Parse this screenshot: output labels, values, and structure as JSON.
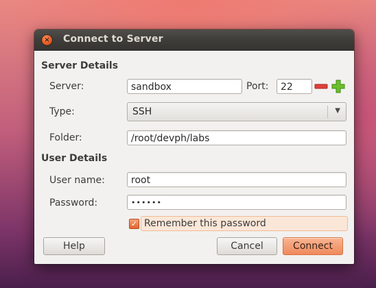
{
  "window": {
    "title": "Connect to Server",
    "close_glyph": "×"
  },
  "server_details": {
    "heading": "Server Details",
    "server_label": "Server:",
    "server_value": "sandbox",
    "port_label": "Port:",
    "port_value": "22",
    "type_label": "Type:",
    "type_value": "SSH",
    "folder_label": "Folder:",
    "folder_value": "/root/devph/labs"
  },
  "user_details": {
    "heading": "User Details",
    "username_label": "User name:",
    "username_value": "root",
    "password_label": "Password:",
    "password_value": "••••••",
    "remember_label": "Remember this password",
    "remember_checked": true
  },
  "buttons": {
    "help": "Help",
    "cancel": "Cancel",
    "connect": "Connect"
  },
  "icons": {
    "close": "close-icon",
    "port_decrement": "minus-icon",
    "port_increment": "plus-icon",
    "dropdown": "chevron-down-icon",
    "checkmark": "checkmark-icon"
  },
  "colors": {
    "accent": "#ef8a5d",
    "titlebar": "#3d3c38",
    "minus": "#e0403a",
    "plus": "#6cbf2a"
  }
}
